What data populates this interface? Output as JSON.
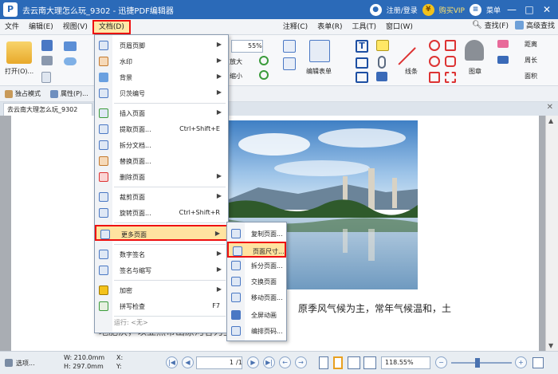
{
  "window": {
    "title": "去云南大理怎么玩_9302 - 迅捷PDF编辑器",
    "logo": "P",
    "login": "注册/登录",
    "buy_vip": "购买VIP",
    "menu_label": "菜单",
    "min_icon": "minimize-icon",
    "max_icon": "maximize-icon",
    "close_icon": "close-icon"
  },
  "menubar": {
    "items": [
      "文件",
      "编辑(E)",
      "视图(V)",
      "文档(D)",
      "注释(C)",
      "表单(R)",
      "工具(T)",
      "窗口(W)"
    ],
    "active_index": 3,
    "find": "查找(F)",
    "advanced_find": "高级查找"
  },
  "ribbon": {
    "open_label": "打开(O)...",
    "zoom_value": "55%",
    "zoom_in_label": "放大",
    "zoom_out_label": "缩小",
    "edit_form_label": "编辑表单",
    "lines_label": "线条",
    "stamp_label": "图章",
    "distance_label": "距离",
    "perimeter_label": "周长",
    "area_label": "面积"
  },
  "subbar": {
    "exclusive_mode": "独占模式",
    "properties": "属性(P)..."
  },
  "tab": {
    "title": "去云南大理怎么玩_9302"
  },
  "document": {
    "text_line1": "原季风气候为主，常年气候温和，土",
    "text_line2": "地肥沃，以亚热带山原河谷为主的气候。"
  },
  "doc_menu": {
    "items": [
      {
        "label": "页眉页脚",
        "shortcut": "",
        "submenu": true
      },
      {
        "label": "水印",
        "shortcut": "",
        "submenu": true
      },
      {
        "label": "背景",
        "shortcut": "",
        "submenu": true
      },
      {
        "label": "贝茨编号",
        "shortcut": "",
        "submenu": true
      },
      {
        "label": "插入页面",
        "shortcut": "",
        "submenu": true
      },
      {
        "label": "提取页面...",
        "shortcut": "Ctrl+Shift+E",
        "submenu": false
      },
      {
        "label": "拆分文档...",
        "shortcut": "",
        "submenu": false
      },
      {
        "label": "替换页面...",
        "shortcut": "",
        "submenu": false
      },
      {
        "label": "删除页面",
        "shortcut": "",
        "submenu": true
      },
      {
        "label": "裁剪页面",
        "shortcut": "",
        "submenu": true
      },
      {
        "label": "旋转页面...",
        "shortcut": "Ctrl+Shift+R",
        "submenu": false
      },
      {
        "label": "更多页面",
        "shortcut": "",
        "submenu": true
      },
      {
        "label": "数字签名",
        "shortcut": "",
        "submenu": true
      },
      {
        "label": "签名与缩写",
        "shortcut": "",
        "submenu": true
      },
      {
        "label": "加密",
        "shortcut": "",
        "submenu": true
      },
      {
        "label": "拼写检查",
        "shortcut": "F7",
        "submenu": false
      }
    ],
    "run_label": "运行: <无>"
  },
  "more_pages_submenu": {
    "items": [
      "复制页面...",
      "页面尺寸...",
      "拆分页面...",
      "交换页面",
      "移动页面...",
      "全屏动画",
      "编排页码..."
    ]
  },
  "statusbar": {
    "options": "选项...",
    "width": "W: 210.0mm",
    "height": "H: 297.0mm",
    "x_label": "X:",
    "y_label": "Y:",
    "page_field": "1",
    "page_total": "/1",
    "zoom": "118.55%"
  },
  "colors": {
    "titlebar": "#2b6ab8",
    "highlight_border": "#e11111",
    "highlight_fill": "#ffe3a0"
  }
}
